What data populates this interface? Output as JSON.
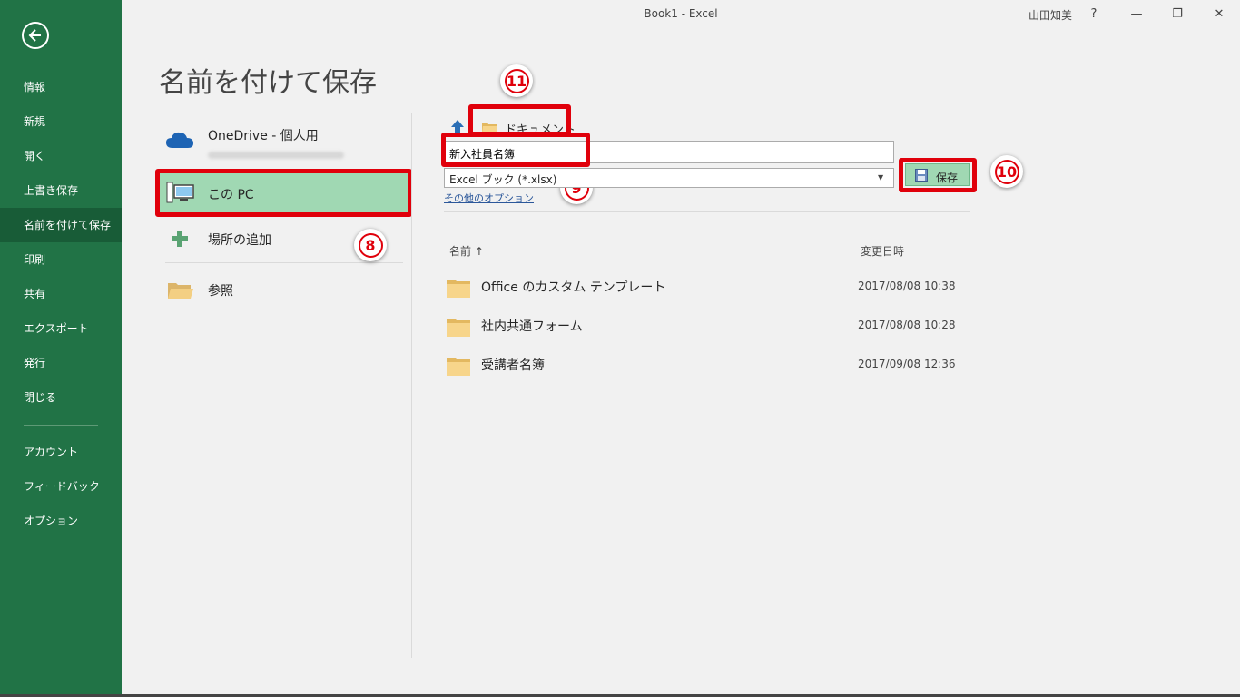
{
  "window": {
    "title": "Book1  -  Excel",
    "user": "山田知美",
    "help": "?",
    "minimize": "—",
    "restore": "❐",
    "close": "✕"
  },
  "sidebar": {
    "items": [
      {
        "label": "情報"
      },
      {
        "label": "新規"
      },
      {
        "label": "開く"
      },
      {
        "label": "上書き保存"
      },
      {
        "label": "名前を付けて保存"
      },
      {
        "label": "印刷"
      },
      {
        "label": "共有"
      },
      {
        "label": "エクスポート"
      },
      {
        "label": "発行"
      },
      {
        "label": "閉じる"
      },
      {
        "label": "アカウント"
      },
      {
        "label": "フィードバック"
      },
      {
        "label": "オプション"
      }
    ],
    "active_index": 4
  },
  "page": {
    "title": "名前を付けて保存"
  },
  "locations": {
    "onedrive": "OneDrive - 個人用",
    "this_pc": "この PC",
    "add_place": "場所の追加",
    "browse": "参照"
  },
  "save_panel": {
    "breadcrumb": "ドキュメント",
    "filename": "新入社員名簿",
    "filetype": "Excel ブック (*.xlsx)",
    "more_options": "その他のオプション",
    "save_button": "保存"
  },
  "file_list": {
    "columns": {
      "name": "名前 ↑",
      "modified": "変更日時"
    },
    "rows": [
      {
        "name": "Office のカスタム テンプレート",
        "modified": "2017/08/08 10:38"
      },
      {
        "name": "社内共通フォーム",
        "modified": "2017/08/08 10:28"
      },
      {
        "name": "受講者名簿",
        "modified": "2017/09/08 12:36"
      }
    ]
  },
  "callouts": {
    "badge_8": "8",
    "badge_9": "9",
    "badge_10": "10",
    "badge_11": "11"
  },
  "colors": {
    "sidebar": "#217346",
    "sidebar_active": "#185c37",
    "selection": "#a0d8b3",
    "highlight_box": "#e0000b",
    "link": "#2b579a"
  }
}
